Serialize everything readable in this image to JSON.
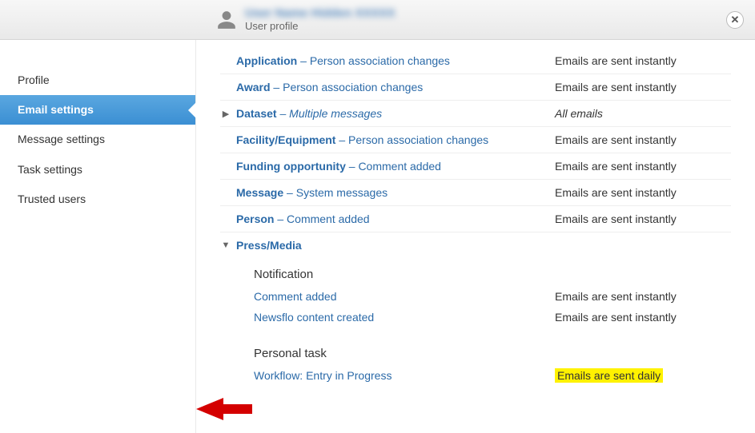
{
  "header": {
    "obscured_name": "User Name Hidden XXXXX",
    "subtitle": "User profile"
  },
  "sidebar": {
    "items": [
      {
        "label": "Profile",
        "active": false
      },
      {
        "label": "Email settings",
        "active": true
      },
      {
        "label": "Message settings",
        "active": false
      },
      {
        "label": "Task settings",
        "active": false
      },
      {
        "label": "Trusted users",
        "active": false
      }
    ]
  },
  "rows": [
    {
      "cat": "Application",
      "desc": "Person association changes",
      "status": "Emails are sent instantly"
    },
    {
      "cat": "Award",
      "desc": "Person association changes",
      "status": "Emails are sent instantly"
    },
    {
      "cat": "Dataset",
      "desc": "Multiple messages",
      "status": "All emails",
      "collapsed": true,
      "italic": true
    },
    {
      "cat": "Facility/Equipment",
      "desc": "Person association changes",
      "status": "Emails are sent instantly"
    },
    {
      "cat": "Funding opportunity",
      "desc": "Comment added",
      "status": "Emails are sent instantly"
    },
    {
      "cat": "Message",
      "desc": "System messages",
      "status": "Emails are sent instantly"
    },
    {
      "cat": "Person",
      "desc": "Comment added",
      "status": "Emails are sent instantly"
    }
  ],
  "expanded": {
    "cat": "Press/Media",
    "sections": [
      {
        "heading": "Notification",
        "items": [
          {
            "label": "Comment added",
            "status": "Emails are sent instantly"
          },
          {
            "label": "Newsflo content created",
            "status": "Emails are sent instantly"
          }
        ]
      },
      {
        "heading": "Personal task",
        "items": [
          {
            "label": "Workflow: Entry in Progress",
            "status": "Emails are sent daily",
            "highlight": true
          }
        ]
      }
    ]
  }
}
